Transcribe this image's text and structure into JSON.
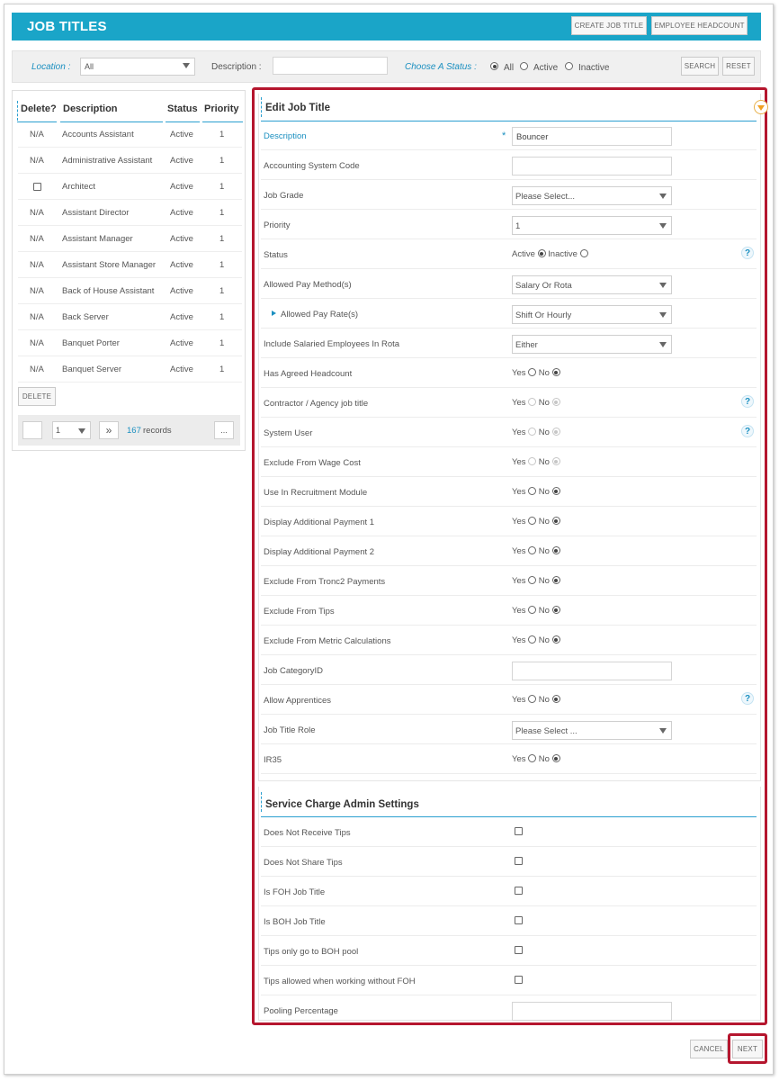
{
  "header": {
    "title": "JOB TITLES",
    "create_btn": "CREATE JOB TITLE",
    "headcount_btn": "EMPLOYEE HEADCOUNT"
  },
  "filters": {
    "location_label": "Location :",
    "location_value": "All",
    "description_label": "Description :",
    "description_value": "",
    "status_label": "Choose A Status :",
    "status_options": [
      "All",
      "Active",
      "Inactive"
    ],
    "status_selected": "All",
    "search_btn": "SEARCH",
    "reset_btn": "RESET"
  },
  "list": {
    "columns": [
      "Delete?",
      "Description",
      "Status",
      "Priority"
    ],
    "rows": [
      {
        "delete": "N/A",
        "description": "Accounts Assistant",
        "status": "Active",
        "priority": "1"
      },
      {
        "delete": "N/A",
        "description": "Administrative Assistant",
        "status": "Active",
        "priority": "1"
      },
      {
        "delete": "checkbox",
        "description": "Architect",
        "status": "Active",
        "priority": "1"
      },
      {
        "delete": "N/A",
        "description": "Assistant Director",
        "status": "Active",
        "priority": "1"
      },
      {
        "delete": "N/A",
        "description": "Assistant Manager",
        "status": "Active",
        "priority": "1"
      },
      {
        "delete": "N/A",
        "description": "Assistant Store Manager",
        "status": "Active",
        "priority": "1"
      },
      {
        "delete": "N/A",
        "description": "Back of House Assistant",
        "status": "Active",
        "priority": "1"
      },
      {
        "delete": "N/A",
        "description": "Back Server",
        "status": "Active",
        "priority": "1"
      },
      {
        "delete": "N/A",
        "description": "Banquet Porter",
        "status": "Active",
        "priority": "1"
      },
      {
        "delete": "N/A",
        "description": "Banquet Server",
        "status": "Active",
        "priority": "1"
      }
    ],
    "delete_btn": "DELETE",
    "pager": {
      "page": "1",
      "next": "»",
      "count": "167",
      "records_label": "records",
      "more": "..."
    }
  },
  "edit": {
    "title": "Edit  Job Title",
    "fields": [
      {
        "label": "Description",
        "type": "input",
        "value": "Bouncer",
        "required": true
      },
      {
        "label": "Accounting System Code",
        "type": "input",
        "value": ""
      },
      {
        "label": "Job Grade",
        "type": "select",
        "value": "Please Select..."
      },
      {
        "label": "Priority",
        "type": "select",
        "value": "1"
      },
      {
        "label": "Status",
        "type": "status",
        "value": "Active",
        "help": true
      },
      {
        "label": "Allowed Pay Method(s)",
        "type": "select",
        "value": "Salary Or Rota"
      },
      {
        "label": "Allowed Pay Rate(s)",
        "type": "select",
        "value": "Shift Or Hourly",
        "sub": true
      },
      {
        "label": "Include Salaried Employees In Rota",
        "type": "select",
        "value": "Either"
      },
      {
        "label": "Has Agreed Headcount",
        "type": "yesno",
        "value": "No"
      },
      {
        "label": "Contractor / Agency job title",
        "type": "yesno",
        "value": "No",
        "disabled": true,
        "help": true
      },
      {
        "label": "System User",
        "type": "yesno",
        "value": "No",
        "disabled": true,
        "help": true
      },
      {
        "label": "Exclude From Wage Cost",
        "type": "yesno",
        "value": "No",
        "disabled": true
      },
      {
        "label": "Use In Recruitment Module",
        "type": "yesno",
        "value": "No"
      },
      {
        "label": "Display Additional Payment 1",
        "type": "yesno",
        "value": "No"
      },
      {
        "label": "Display Additional Payment 2",
        "type": "yesno",
        "value": "No"
      },
      {
        "label": "Exclude From Tronc2 Payments",
        "type": "yesno",
        "value": "No"
      },
      {
        "label": "Exclude From Tips",
        "type": "yesno",
        "value": "No"
      },
      {
        "label": "Exclude From Metric Calculations",
        "type": "yesno",
        "value": "No"
      },
      {
        "label": "Job CategoryID",
        "type": "input",
        "value": ""
      },
      {
        "label": "Allow Apprentices",
        "type": "yesno",
        "value": "No",
        "help": true
      },
      {
        "label": "Job Title Role",
        "type": "select",
        "value": "Please Select ..."
      },
      {
        "label": "IR35",
        "type": "yesno",
        "value": "No"
      }
    ],
    "yes_label": "Yes",
    "no_label": "No",
    "active_label": "Active",
    "inactive_label": "Inactive",
    "help_glyph": "?"
  },
  "service": {
    "title": "Service Charge Admin Settings",
    "fields": [
      {
        "label": "Does Not Receive Tips",
        "type": "checkbox"
      },
      {
        "label": "Does Not Share Tips",
        "type": "checkbox"
      },
      {
        "label": "Is FOH Job Title",
        "type": "checkbox"
      },
      {
        "label": "Is BOH Job Title",
        "type": "checkbox"
      },
      {
        "label": "Tips only go to BOH pool",
        "type": "checkbox"
      },
      {
        "label": "Tips allowed when working without FOH",
        "type": "checkbox"
      },
      {
        "label": "Pooling Percentage",
        "type": "input",
        "value": ""
      }
    ]
  },
  "footer": {
    "cancel_btn": "CANCEL",
    "next_btn": "NEXT"
  },
  "colors": {
    "brand": "#1aa5c8",
    "highlight": "#b5162e",
    "link": "#1a8fc0"
  }
}
